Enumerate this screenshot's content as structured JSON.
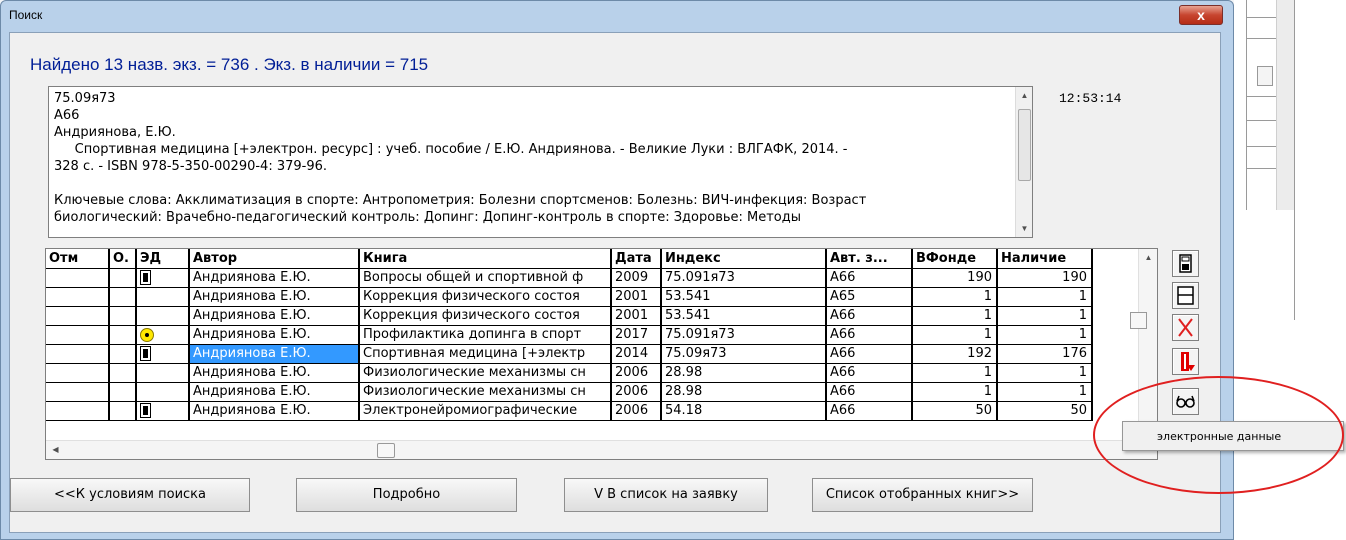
{
  "colors": {
    "dialog_frame": "#b9d1ea",
    "found_text": "#001e96",
    "selection": "#3399ff",
    "annotation": "#e02020"
  },
  "window": {
    "title": "Поиск",
    "close_glyph": "x"
  },
  "found_line": "Найдено 13 назв. экз. = 736 . Экз. в наличии =  715",
  "clock": "12:53:14",
  "record": {
    "lines": [
      "75.09я73",
      "А66",
      "Андриянова, Е.Ю.",
      "     Спортивная медицина [+электрон. ресурс] : учеб. пособие / Е.Ю. Андриянова. - Великие Луки : ВЛГАФК, 2014. -",
      "328 с. - ISBN 978-5-350-00290-4: 379-96.",
      "",
      "Ключевые слова: Акклиматизация в спорте: Антропометрия: Болезни спортсменов: Болезнь: ВИЧ-инфекция: Возраст",
      "биологический: Врачебно-педагогический контроль: Допинг: Допинг-контроль в спорте: Здоровье: Методы"
    ]
  },
  "table": {
    "columns": [
      "Отм",
      "О.",
      "ЭД",
      "Автор",
      "Книга",
      "Дата",
      "Индекс",
      "Авт. з...",
      "ВФонде",
      "Наличие"
    ],
    "rows": [
      {
        "otm": "",
        "o": "",
        "ed": "square",
        "author": "Андриянова Е.Ю.",
        "book": "Вопросы общей и спортивной ф",
        "date": "2009",
        "index": "75.091я73",
        "code": "А66",
        "vfonde": "190",
        "nalichie": "190"
      },
      {
        "otm": "",
        "o": "",
        "ed": "",
        "author": "Андриянова Е.Ю.",
        "book": "Коррекция физического состоя",
        "date": "2001",
        "index": "53.541",
        "code": "А65",
        "vfonde": "1",
        "nalichie": "1"
      },
      {
        "otm": "",
        "o": "",
        "ed": "",
        "author": "Андриянова Е.Ю.",
        "book": "Коррекция физического состоя",
        "date": "2001",
        "index": "53.541",
        "code": "А66",
        "vfonde": "1",
        "nalichie": "1"
      },
      {
        "otm": "",
        "o": "",
        "ed": "dot",
        "author": "Андриянова Е.Ю.",
        "book": "Профилактика допинга в спорт",
        "date": "2017",
        "index": "75.091я73",
        "code": "А66",
        "vfonde": "1",
        "nalichie": "1"
      },
      {
        "otm": "",
        "o": "",
        "ed": "square",
        "author": "Андриянова Е.Ю.",
        "book": "Спортивная медицина [+электр",
        "date": "2014",
        "index": "75.09я73",
        "code": "А66",
        "vfonde": "192",
        "nalichie": "176",
        "selected": true
      },
      {
        "otm": "",
        "o": "",
        "ed": "",
        "author": "Андриянова Е.Ю.",
        "book": "Физиологические механизмы сн",
        "date": "2006",
        "index": "28.98",
        "code": "А66",
        "vfonde": "1",
        "nalichie": "1"
      },
      {
        "otm": "",
        "o": "",
        "ed": "",
        "author": "Андриянова Е.Ю.",
        "book": "Физиологические механизмы сн",
        "date": "2006",
        "index": "28.98",
        "code": "А66",
        "vfonde": "1",
        "nalichie": "1"
      },
      {
        "otm": "",
        "o": "",
        "ed": "square",
        "author": "Андриянова Е.Ю.",
        "book": "Электронейромиографические",
        "date": "2006",
        "index": "54.18",
        "code": "А66",
        "vfonde": "50",
        "nalichie": "50"
      }
    ]
  },
  "side_buttons": [
    "save-all-icon",
    "save-icon",
    "delete-icon",
    "exit-icon",
    "glasses-icon"
  ],
  "popup": {
    "label": "электронные данные"
  },
  "buttons": {
    "back": "<<К условиям поиска",
    "details": "Подробно",
    "to_order": "V В список на заявку",
    "selected_list": "Список отобранных книг>>"
  }
}
